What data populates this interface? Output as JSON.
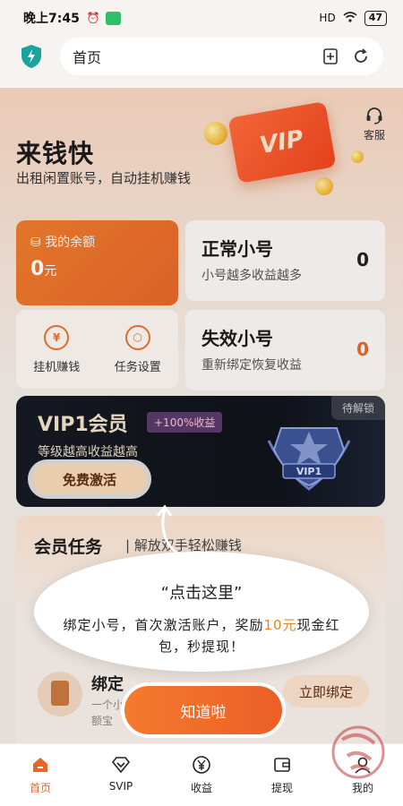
{
  "status_bar": {
    "time": "晚上7:45",
    "signal": "HD",
    "battery": "47"
  },
  "browser": {
    "url_text": "首页"
  },
  "hero": {
    "title": "来钱快",
    "subtitle": "出租闲置账号，自动挂机赚钱",
    "service_label": "客服",
    "card_text": "VIP"
  },
  "balance": {
    "label": "我的余额",
    "amount": "0",
    "unit": "元"
  },
  "quick_actions": [
    {
      "label": "挂机赚钱",
      "glyph": "¥"
    },
    {
      "label": "任务设置",
      "glyph": "⬡"
    }
  ],
  "accounts": [
    {
      "title": "正常小号",
      "desc": "小号越多收益越多",
      "count": "0"
    },
    {
      "title": "失效小号",
      "desc": "重新绑定恢复收益",
      "count": "0"
    }
  ],
  "vip": {
    "title": "VIP1会员",
    "badge": "+100%收益",
    "desc": "等级越高收益越高",
    "button": "免费激活",
    "lock": "待解锁",
    "emblem_text": "VIP1"
  },
  "tasks": {
    "title": "会员任务",
    "subtitle": "| 解放双手轻松赚钱",
    "row_title": "绑定",
    "row_desc1": "一个小",
    "row_desc2": "额宝",
    "bind_button": "立即绑定"
  },
  "popup": {
    "title": "“点击这里”",
    "text_before": "绑定小号，首次激活账户，奖励",
    "highlight": "10元",
    "text_after": "现金红包，秒提现！",
    "button": "知道啦"
  },
  "nav": [
    {
      "label": "首页",
      "icon": "home-icon",
      "active": true
    },
    {
      "label": "SVIP",
      "icon": "diamond-icon",
      "active": false
    },
    {
      "label": "收益",
      "icon": "yuan-icon",
      "active": false
    },
    {
      "label": "提现",
      "icon": "wallet-icon",
      "active": false
    },
    {
      "label": "我的",
      "icon": "user-icon",
      "active": false
    }
  ],
  "colors": {
    "accent": "#E5672A",
    "vip_bg": "#171A22",
    "highlight": "#E7852B"
  }
}
